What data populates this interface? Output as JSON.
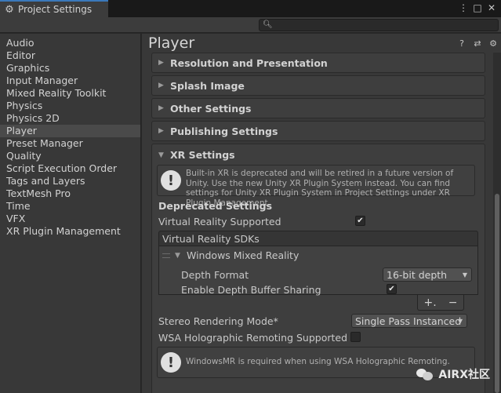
{
  "window": {
    "tab_title": "Project Settings",
    "icon": "gear-icon"
  },
  "search": {
    "placeholder": ""
  },
  "sidebar": {
    "items": [
      {
        "label": "Audio"
      },
      {
        "label": "Editor"
      },
      {
        "label": "Graphics"
      },
      {
        "label": "Input Manager"
      },
      {
        "label": "Mixed Reality Toolkit"
      },
      {
        "label": "Physics"
      },
      {
        "label": "Physics 2D"
      },
      {
        "label": "Player",
        "selected": true
      },
      {
        "label": "Preset Manager"
      },
      {
        "label": "Quality"
      },
      {
        "label": "Script Execution Order"
      },
      {
        "label": "Tags and Layers"
      },
      {
        "label": "TextMesh Pro"
      },
      {
        "label": "Time"
      },
      {
        "label": "VFX"
      },
      {
        "label": "XR Plugin Management"
      }
    ]
  },
  "main": {
    "title": "Player",
    "sections": [
      {
        "label": "Resolution and Presentation"
      },
      {
        "label": "Splash Image"
      },
      {
        "label": "Other Settings"
      },
      {
        "label": "Publishing Settings"
      }
    ],
    "xr": {
      "label": "XR Settings",
      "deprecation_notice": "Built-in XR is deprecated and will be retired in a future version of Unity. Use the new Unity XR Plugin System instead. You can find settings for Unity XR Plugin System in Project Settings under XR Plugin Management.",
      "deprecated_header": "Deprecated Settings",
      "vr_supported_label": "Virtual Reality Supported",
      "vr_supported": true,
      "sdk_header": "Virtual Reality SDKs",
      "sdk_item": "Windows Mixed Reality",
      "depth_format_label": "Depth Format",
      "depth_format_value": "16-bit depth",
      "depth_sharing_label": "Enable Depth Buffer Sharing",
      "depth_sharing": true,
      "add_label": "+.",
      "remove_label": "−",
      "stereo_label": "Stereo Rendering Mode*",
      "stereo_value": "Single Pass Instanced",
      "holo_label": "WSA Holographic Remoting Supported",
      "holo_checked": false,
      "wmr_notice": "WindowsMR is required when using WSA Holographic Remoting."
    }
  },
  "watermark": {
    "text": "AIRX社区"
  }
}
